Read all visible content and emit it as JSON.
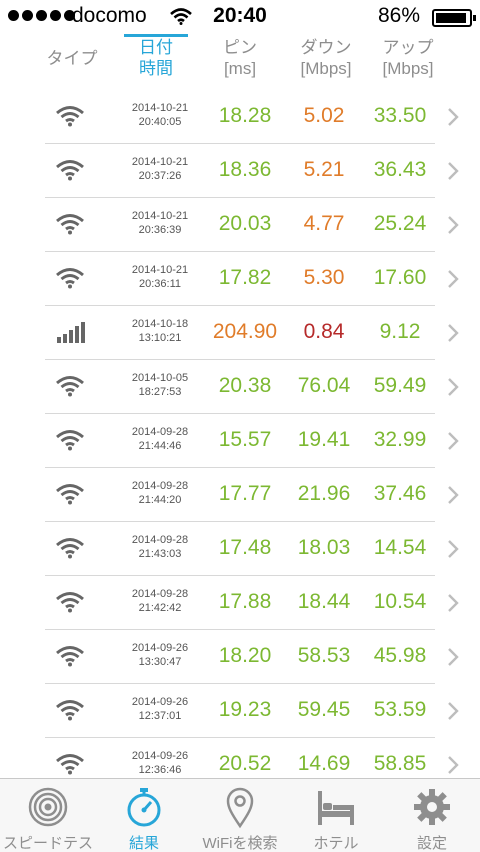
{
  "status_bar": {
    "carrier": "docomo",
    "time": "20:40",
    "battery": "86%"
  },
  "header": {
    "type": "タイプ",
    "date_line1": "日付",
    "date_line2": "時間",
    "ping_line1": "ピン",
    "ping_line2": "[ms]",
    "down_line1": "ダウン",
    "down_line2": "[Mbps]",
    "up_line1": "アップ",
    "up_line2": "[Mbps]"
  },
  "colors": {
    "accent": "#27a6d8",
    "good": "#7cb832",
    "warn": "#e07c2a",
    "bad": "#b62a2a"
  },
  "results": [
    {
      "type": "wifi-icon",
      "date": "2014-10-21",
      "time": "20:40:05",
      "ping": "18.28",
      "down": "5.02",
      "up": "33.50",
      "ping_c": "green",
      "down_c": "orange",
      "up_c": "green"
    },
    {
      "type": "wifi-icon",
      "date": "2014-10-21",
      "time": "20:37:26",
      "ping": "18.36",
      "down": "5.21",
      "up": "36.43",
      "ping_c": "green",
      "down_c": "orange",
      "up_c": "green"
    },
    {
      "type": "wifi-icon",
      "date": "2014-10-21",
      "time": "20:36:39",
      "ping": "20.03",
      "down": "4.77",
      "up": "25.24",
      "ping_c": "green",
      "down_c": "orange",
      "up_c": "green"
    },
    {
      "type": "wifi-icon",
      "date": "2014-10-21",
      "time": "20:36:11",
      "ping": "17.82",
      "down": "5.30",
      "up": "17.60",
      "ping_c": "green",
      "down_c": "orange",
      "up_c": "green"
    },
    {
      "type": "cellular-icon",
      "date": "2014-10-18",
      "time": "13:10:21",
      "ping": "204.90",
      "down": "0.84",
      "up": "9.12",
      "ping_c": "orange",
      "down_c": "red",
      "up_c": "green"
    },
    {
      "type": "wifi-icon",
      "date": "2014-10-05",
      "time": "18:27:53",
      "ping": "20.38",
      "down": "76.04",
      "up": "59.49",
      "ping_c": "green",
      "down_c": "green",
      "up_c": "green"
    },
    {
      "type": "wifi-icon",
      "date": "2014-09-28",
      "time": "21:44:46",
      "ping": "15.57",
      "down": "19.41",
      "up": "32.99",
      "ping_c": "green",
      "down_c": "green",
      "up_c": "green"
    },
    {
      "type": "wifi-icon",
      "date": "2014-09-28",
      "time": "21:44:20",
      "ping": "17.77",
      "down": "21.96",
      "up": "37.46",
      "ping_c": "green",
      "down_c": "green",
      "up_c": "green"
    },
    {
      "type": "wifi-icon",
      "date": "2014-09-28",
      "time": "21:43:03",
      "ping": "17.48",
      "down": "18.03",
      "up": "14.54",
      "ping_c": "green",
      "down_c": "green",
      "up_c": "green"
    },
    {
      "type": "wifi-icon",
      "date": "2014-09-28",
      "time": "21:42:42",
      "ping": "17.88",
      "down": "18.44",
      "up": "10.54",
      "ping_c": "green",
      "down_c": "green",
      "up_c": "green"
    },
    {
      "type": "wifi-icon",
      "date": "2014-09-26",
      "time": "13:30:47",
      "ping": "18.20",
      "down": "58.53",
      "up": "45.98",
      "ping_c": "green",
      "down_c": "green",
      "up_c": "green"
    },
    {
      "type": "wifi-icon",
      "date": "2014-09-26",
      "time": "12:37:01",
      "ping": "19.23",
      "down": "59.45",
      "up": "53.59",
      "ping_c": "green",
      "down_c": "green",
      "up_c": "green"
    },
    {
      "type": "wifi-icon",
      "date": "2014-09-26",
      "time": "12:36:46",
      "ping": "20.52",
      "down": "14.69",
      "up": "58.85",
      "ping_c": "green",
      "down_c": "green",
      "up_c": "green"
    }
  ],
  "tabs": [
    {
      "label": "スピードテスト",
      "icon": "speedtest-icon",
      "active": false
    },
    {
      "label": "結果",
      "icon": "stopwatch-icon",
      "active": true
    },
    {
      "label": "WiFiを検索",
      "icon": "location-pin-icon",
      "active": false
    },
    {
      "label": "ホテル",
      "icon": "bed-icon",
      "active": false
    },
    {
      "label": "設定",
      "icon": "gear-icon",
      "active": false
    }
  ]
}
